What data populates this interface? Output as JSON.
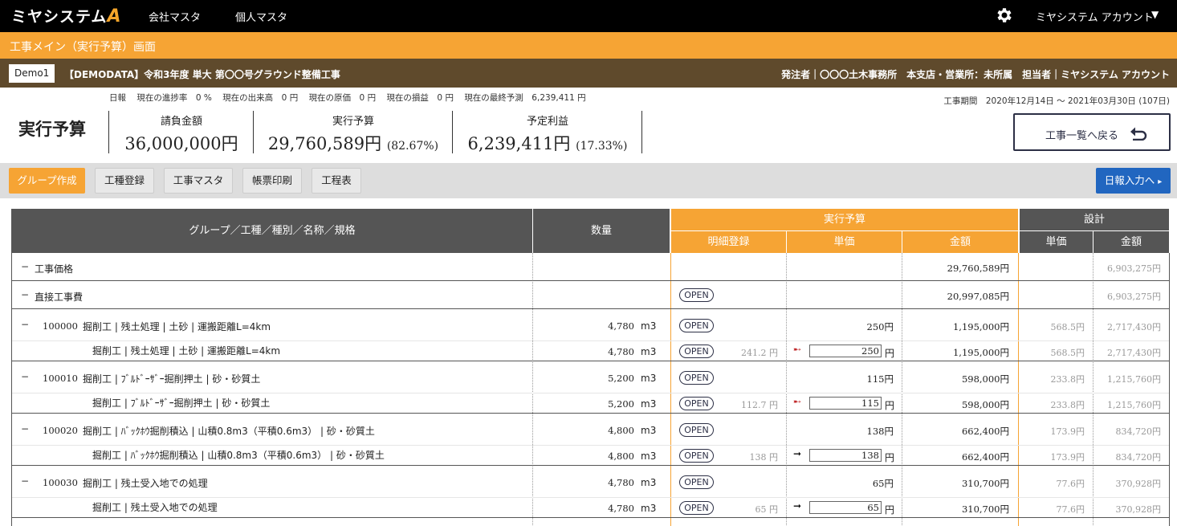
{
  "nav": {
    "logo": "ミヤシステム",
    "logo_mark": "A",
    "links": [
      "会社マスタ",
      "個人マスタ"
    ],
    "account": "ミヤシステム アカウント",
    "account_caret": "▼"
  },
  "title_bar": {
    "title": "工事メイン（実行予算）画面"
  },
  "info_bar": {
    "badge": "Demo1",
    "project": "【DEMODATA】令和3年度 単大 第〇〇号グラウンド整備工事",
    "meta": "発注者｜〇〇〇土木事務所　本支店・営業所：未所属　担当者｜ミヤシステム アカウント"
  },
  "summary": {
    "items": [
      "日報",
      "現在の進捗率　0 %",
      "現在の出来高　0 円",
      "現在の原価　0 円",
      "現在の損益　0 円",
      "現在の最終予測　6,239,411 円"
    ],
    "period": "工事期間　2020年12月14日 〜 2021年03月30日 (107日)",
    "heading": "実行予算",
    "metrics": [
      {
        "label": "請負金額",
        "value": "36,000,000円",
        "pct": ""
      },
      {
        "label": "実行予算",
        "value": "29,760,589円",
        "pct": "(82.67%)"
      },
      {
        "label": "予定利益",
        "value": "6,239,411円",
        "pct": "(17.33%)"
      }
    ],
    "back_button": "工事一覧へ戻る"
  },
  "toolbar": {
    "buttons": [
      "グループ作成",
      "工種登録",
      "工事マスタ",
      "帳票印刷",
      "工程表"
    ],
    "daily_button": "日報入力へ",
    "daily_arrow": "▸"
  },
  "table": {
    "headers": {
      "name": "グループ／工種／種別／名称／規格",
      "qty": "数量",
      "exec": "実行予算",
      "detail": "明細登録",
      "unit_price": "単価",
      "amount": "金額",
      "design": "設計",
      "d_unit_price": "単価",
      "d_amount": "金額"
    },
    "open_label": "OPEN",
    "yen": "円",
    "minus": "−",
    "rows": [
      {
        "code": "",
        "name": "工事価格",
        "qty": "",
        "unit": "",
        "detail": "",
        "open": false,
        "unit_price": "",
        "amount": "29,760,589円",
        "d_unit": "",
        "d_amount": "6,903,275円"
      },
      {
        "code": "",
        "name": "直接工事費",
        "qty": "",
        "unit": "",
        "detail": "",
        "open": true,
        "unit_price": "",
        "amount": "20,997,085円",
        "d_unit": "",
        "d_amount": "6,903,275円"
      },
      {
        "code": "100000",
        "name": "掘削工 | 残土処理 | 土砂 | 運搬距離L=4km",
        "qty": "4,780",
        "unit": "m3",
        "open": true,
        "unit_price": "250円",
        "amount": "1,195,000円",
        "d_unit": "568.5円",
        "d_amount": "2,717,430円",
        "sub": {
          "name": "掘削工 | 残土処理 | 土砂 | 運搬距離L=4km",
          "qty": "4,780",
          "unit": "m3",
          "detail": "241.2 円",
          "arrow": "➸",
          "input": "250",
          "amount": "1,195,000円",
          "d_unit": "568.5円",
          "d_amount": "2,717,430円"
        }
      },
      {
        "code": "100010",
        "name": "掘削工 | ﾌﾞﾙﾄﾞｰｻﾞｰ掘削押土 | 砂・砂質土",
        "qty": "5,200",
        "unit": "m3",
        "open": true,
        "unit_price": "115円",
        "amount": "598,000円",
        "d_unit": "233.8円",
        "d_amount": "1,215,760円",
        "sub": {
          "name": "掘削工 | ﾌﾞﾙﾄﾞｰｻﾞｰ掘削押土 | 砂・砂質土",
          "qty": "5,200",
          "unit": "m3",
          "detail": "112.7 円",
          "arrow": "➸",
          "input": "115",
          "amount": "598,000円",
          "d_unit": "233.8円",
          "d_amount": "1,215,760円"
        }
      },
      {
        "code": "100020",
        "name": "掘削工 | ﾊﾞｯｸﾎｳ掘削積込 | 山積0.8m3（平積0.6m3） | 砂・砂質土",
        "qty": "4,800",
        "unit": "m3",
        "open": true,
        "unit_price": "138円",
        "amount": "662,400円",
        "d_unit": "173.9円",
        "d_amount": "834,720円",
        "sub": {
          "name": "掘削工 | ﾊﾞｯｸﾎｳ掘削積込 | 山積0.8m3（平積0.6m3） | 砂・砂質土",
          "qty": "4,800",
          "unit": "m3",
          "detail": "138 円",
          "arrow": "➞",
          "input": "138",
          "amount": "662,400円",
          "d_unit": "173.9円",
          "d_amount": "834,720円"
        }
      },
      {
        "code": "100030",
        "name": "掘削工 | 残土受入地での処理",
        "qty": "4,780",
        "unit": "m3",
        "open": true,
        "unit_price": "65円",
        "amount": "310,700円",
        "d_unit": "77.6円",
        "d_amount": "370,928円",
        "sub": {
          "name": "掘削工 | 残土受入地での処理",
          "qty": "4,780",
          "unit": "m3",
          "detail": "65 円",
          "arrow": "➞",
          "input": "65",
          "amount": "310,700円",
          "d_unit": "77.6円",
          "d_amount": "370,928円"
        }
      }
    ]
  }
}
